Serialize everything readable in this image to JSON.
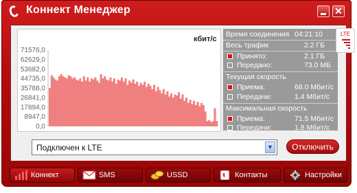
{
  "app": {
    "title": "Коннект Менеджер"
  },
  "chart_data": {
    "type": "area",
    "unit_label": "кбит/с",
    "y_ticks": [
      "71576,0",
      "62629,0",
      "53682,0",
      "44735,0",
      "35788,0",
      "26841,0",
      "17894,0",
      "8947,0",
      "0,0"
    ],
    "ylim": [
      0,
      71576
    ],
    "grid": false,
    "color": "#f08080",
    "values": [
      36000,
      48000,
      46000,
      44000,
      43000,
      47000,
      49000,
      47000,
      46000,
      45000,
      48000,
      47000,
      45000,
      46000,
      44000,
      43000,
      45000,
      42000,
      47000,
      43000,
      46000,
      42000,
      45000,
      44000,
      46000,
      43000,
      41000,
      49000,
      45000,
      47000,
      44000,
      43000,
      46000,
      42000,
      45000,
      40000,
      44000,
      43000,
      46000,
      42000,
      45000,
      39000,
      43000,
      41000,
      44000,
      40000,
      42000,
      38000,
      41000,
      39000,
      42000,
      37000,
      40000,
      38000,
      35000,
      39000,
      33000,
      37000,
      34000,
      31000,
      35000,
      30000,
      33000,
      28000,
      31000,
      27000,
      30000,
      29000,
      32000,
      26000,
      30000,
      24000,
      27000,
      22000,
      25000,
      21000,
      24000,
      20000,
      23000,
      19000,
      22000,
      20000,
      14000,
      5000,
      6000,
      4000,
      5000,
      17000,
      5000
    ]
  },
  "stats": {
    "connection_time_label": "Время соединения",
    "connection_time": "04:21:10",
    "total_traffic_label": "Весь трафик",
    "total_traffic": "2.2 ГБ",
    "received_label": "Принято:",
    "received": "2.1 ГБ",
    "sent_label": "Передано:",
    "sent": "73.0 МБ",
    "current_speed_label": "Текущая скорость",
    "current_rx_label": "Приема:",
    "current_rx": "68.0 Мбит/с",
    "current_tx_label": "Передачи:",
    "current_tx": "1.4 Мбит/с",
    "max_speed_label": "Максимальная скорость",
    "max_rx_label": "Приема:",
    "max_rx": "71.5 Мбит/с",
    "max_tx_label": "Передачи:",
    "max_tx": "1.8 Мбит/с"
  },
  "network_badge": "LTE",
  "status_select": {
    "value": "Подключен к LTE"
  },
  "disconnect_label": "Отключить",
  "nav": [
    {
      "label": "Коннект",
      "icon": "signal-bars-icon"
    },
    {
      "label": "SMS",
      "icon": "envelope-icon"
    },
    {
      "label": "USSD",
      "icon": "coins-icon"
    },
    {
      "label": "Контакты",
      "icon": "phone-book-icon"
    },
    {
      "label": "Настройки",
      "icon": "gear-icon"
    }
  ]
}
